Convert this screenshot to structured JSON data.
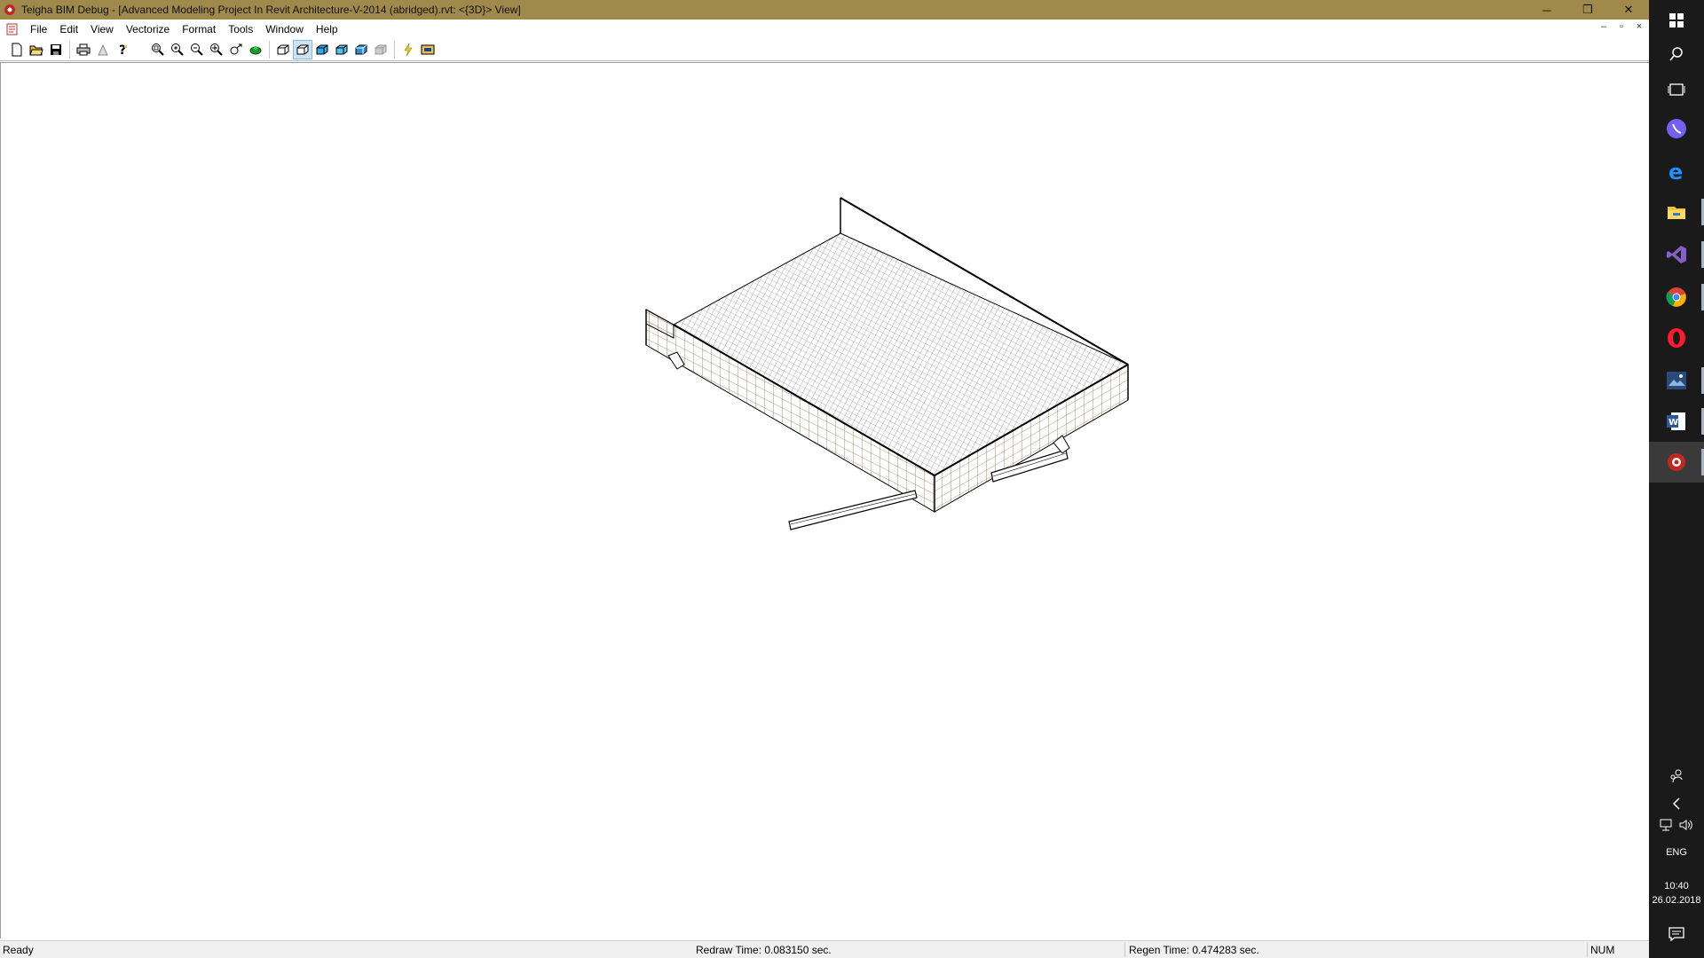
{
  "window": {
    "title": "Teigha BIM Debug - [Advanced Modeling Project In Revit Architecture-V-2014 (abridged).rvt: <{3D}> View]",
    "controls": {
      "minimize": "─",
      "restore": "❐",
      "close": "✕"
    }
  },
  "menu": {
    "items": [
      "File",
      "Edit",
      "View",
      "Vectorize",
      "Format",
      "Tools",
      "Window",
      "Help"
    ],
    "mdi_controls": {
      "minimize": "–",
      "restore": "▫",
      "close": "×"
    }
  },
  "toolbar": {
    "buttons": [
      "new-icon",
      "open-icon",
      "save-icon",
      "print-icon",
      "print-preview-icon",
      "help-icon",
      "zoom-window-icon",
      "zoom-in-icon",
      "zoom-out-icon",
      "zoom-extents-icon",
      "pan-icon",
      "orbit-icon",
      "wireframe-icon",
      "hidden-line-icon",
      "flat-shaded-icon",
      "gouraud-shaded-icon",
      "shaded-edges-icon",
      "render-icon",
      "regen-icon",
      "properties-icon"
    ],
    "active": "hidden-line-icon"
  },
  "status": {
    "ready": "Ready",
    "redraw": "Redraw Time: 0.083150 sec.",
    "regen": "Regen Time: 0.474283 sec.",
    "num": "NUM"
  },
  "taskbar": {
    "apps": [
      "start-icon",
      "search-icon",
      "task-view-icon",
      "viber-icon",
      "edge-icon",
      "file-explorer-icon",
      "visual-studio-icon",
      "chrome-icon",
      "opera-icon",
      "photo-app-icon",
      "word-icon",
      "teigha-icon"
    ],
    "tray": {
      "lang": "ENG",
      "time": "10:40",
      "date": "26.02.2018"
    }
  }
}
